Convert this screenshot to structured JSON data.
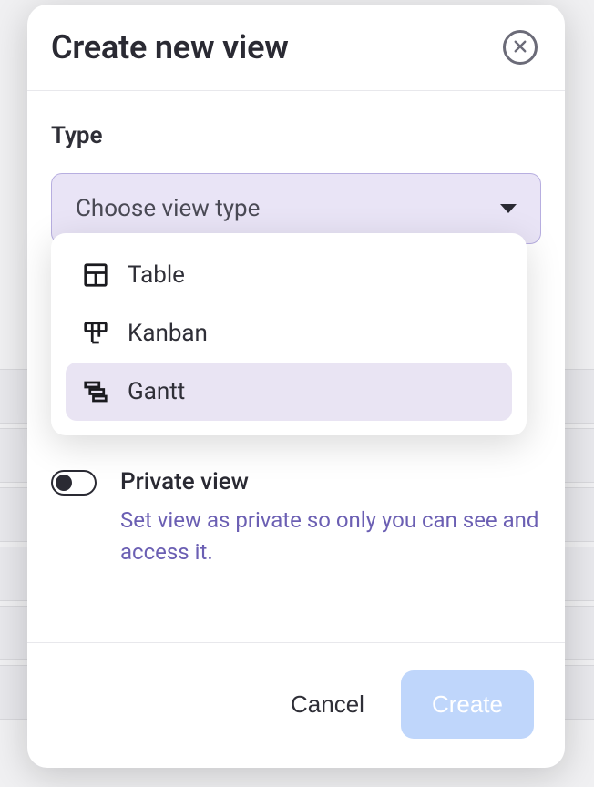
{
  "modal": {
    "title": "Create new view",
    "type_label": "Type",
    "select_placeholder": "Choose view type",
    "options": [
      {
        "label": "Table"
      },
      {
        "label": "Kanban"
      },
      {
        "label": "Gantt"
      }
    ],
    "private": {
      "title": "Private view",
      "description": "Set view as private so only you can see and access it."
    },
    "footer": {
      "cancel": "Cancel",
      "create": "Create"
    }
  }
}
